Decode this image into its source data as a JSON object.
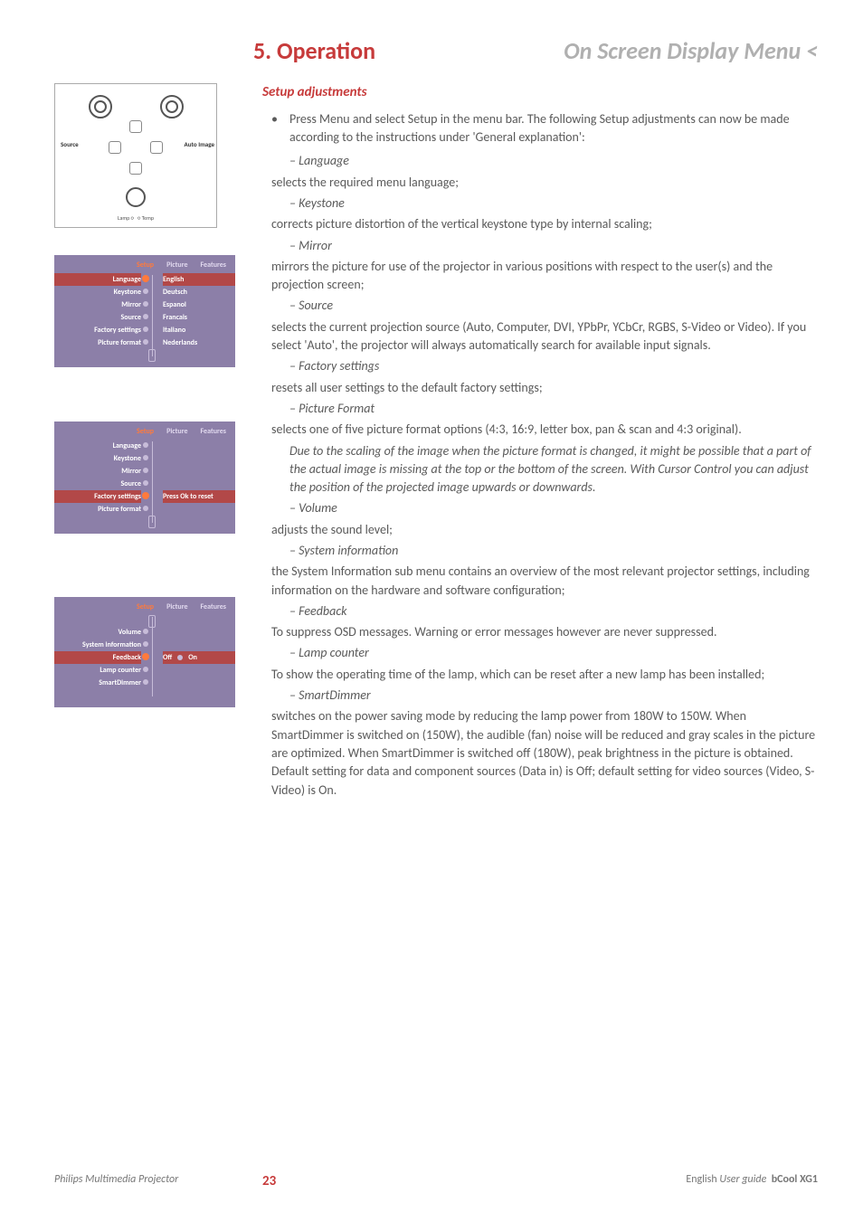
{
  "header": {
    "left": "5. Operation",
    "right": "On Screen Display Menu <"
  },
  "subtitle": "Setup adjustments",
  "intro": "Press Menu and select Setup in the menu bar. The following Setup adjustments can now be made according to the instructions under 'General explanation':",
  "items": {
    "language": {
      "name": "– Language",
      "desc": "selects the required menu language;"
    },
    "keystone": {
      "name": "– Keystone",
      "desc": "corrects picture distortion of the vertical keystone type by internal scaling;"
    },
    "mirror": {
      "name": "– Mirror",
      "desc": "mirrors the picture for use of the projector in various positions with respect to the user(s) and the projection screen;"
    },
    "source": {
      "name": "– Source",
      "desc": "selects the current projection source (Auto, Computer, DVI, YPbPr, YCbCr, RGBS, S-Video or Video). If you select 'Auto', the projector will always automatically search for available input signals."
    },
    "factory": {
      "name": "– Factory settings",
      "desc": "resets all user settings to the default factory settings;"
    },
    "format": {
      "name": "– Picture Format",
      "desc": "selects one of five picture format options (4:3, 16:9, letter box, pan & scan and 4:3 original)."
    },
    "format_note": "Due to the scaling of the image when the picture format is changed, it might be possible that a part of the actual image is missing at the top or the bottom of the screen. With Cursor Control you can adjust the position of the projected image upwards or downwards.",
    "volume": {
      "name": "– Volume",
      "desc": "adjusts the sound level;"
    },
    "sysinfo": {
      "name": "– System information",
      "desc": "the System Information sub menu contains an overview of the most relevant projector settings, including information on the hardware and software configuration;"
    },
    "feedback": {
      "name": "– Feedback",
      "desc": "To suppress OSD messages. Warning or error messages however are never suppressed."
    },
    "lamp": {
      "name": "– Lamp counter",
      "desc": "To show the operating time of the lamp, which can be reset after a new lamp has been installed;"
    },
    "smart": {
      "name": "– SmartDimmer",
      "desc": "switches on the power saving mode by reducing the lamp power from 180W to 150W. When SmartDimmer is switched on (150W),  the audible (fan) noise will be reduced and gray scales in the picture are optimized. When SmartDimmer is switched off (180W), peak brightness in the picture is obtained. Default setting for data and component sources (Data in) is Off; default setting for video sources (Video, S-Video) is On."
    }
  },
  "panel": {
    "source": "Source",
    "autoimage": "Auto Image",
    "lamp": "Lamp",
    "temp": "Temp"
  },
  "osd_tabs": {
    "setup": "Setup",
    "picture": "Picture",
    "features": "Features"
  },
  "osd1": {
    "left": [
      "Language",
      "Keystone",
      "Mirror",
      "Source",
      "Factory settings",
      "Picture format"
    ],
    "right": [
      "English",
      "Deutsch",
      "Espanol",
      "Francais",
      "Italiano",
      "Nederlands"
    ]
  },
  "osd2": {
    "left": [
      "Language",
      "Keystone",
      "Mirror",
      "Source",
      "Factory settings",
      "Picture format"
    ],
    "right_label": "Press Ok to reset"
  },
  "osd3": {
    "left": [
      "Volume",
      "System information",
      "Feedback",
      "Lamp counter",
      "SmartDimmer"
    ],
    "off": "Off",
    "on": "On"
  },
  "footer": {
    "left": "Philips Multimedia Projector",
    "page": "23",
    "lang": "English",
    "guide": "User guide",
    "model": "bCool XG1"
  }
}
